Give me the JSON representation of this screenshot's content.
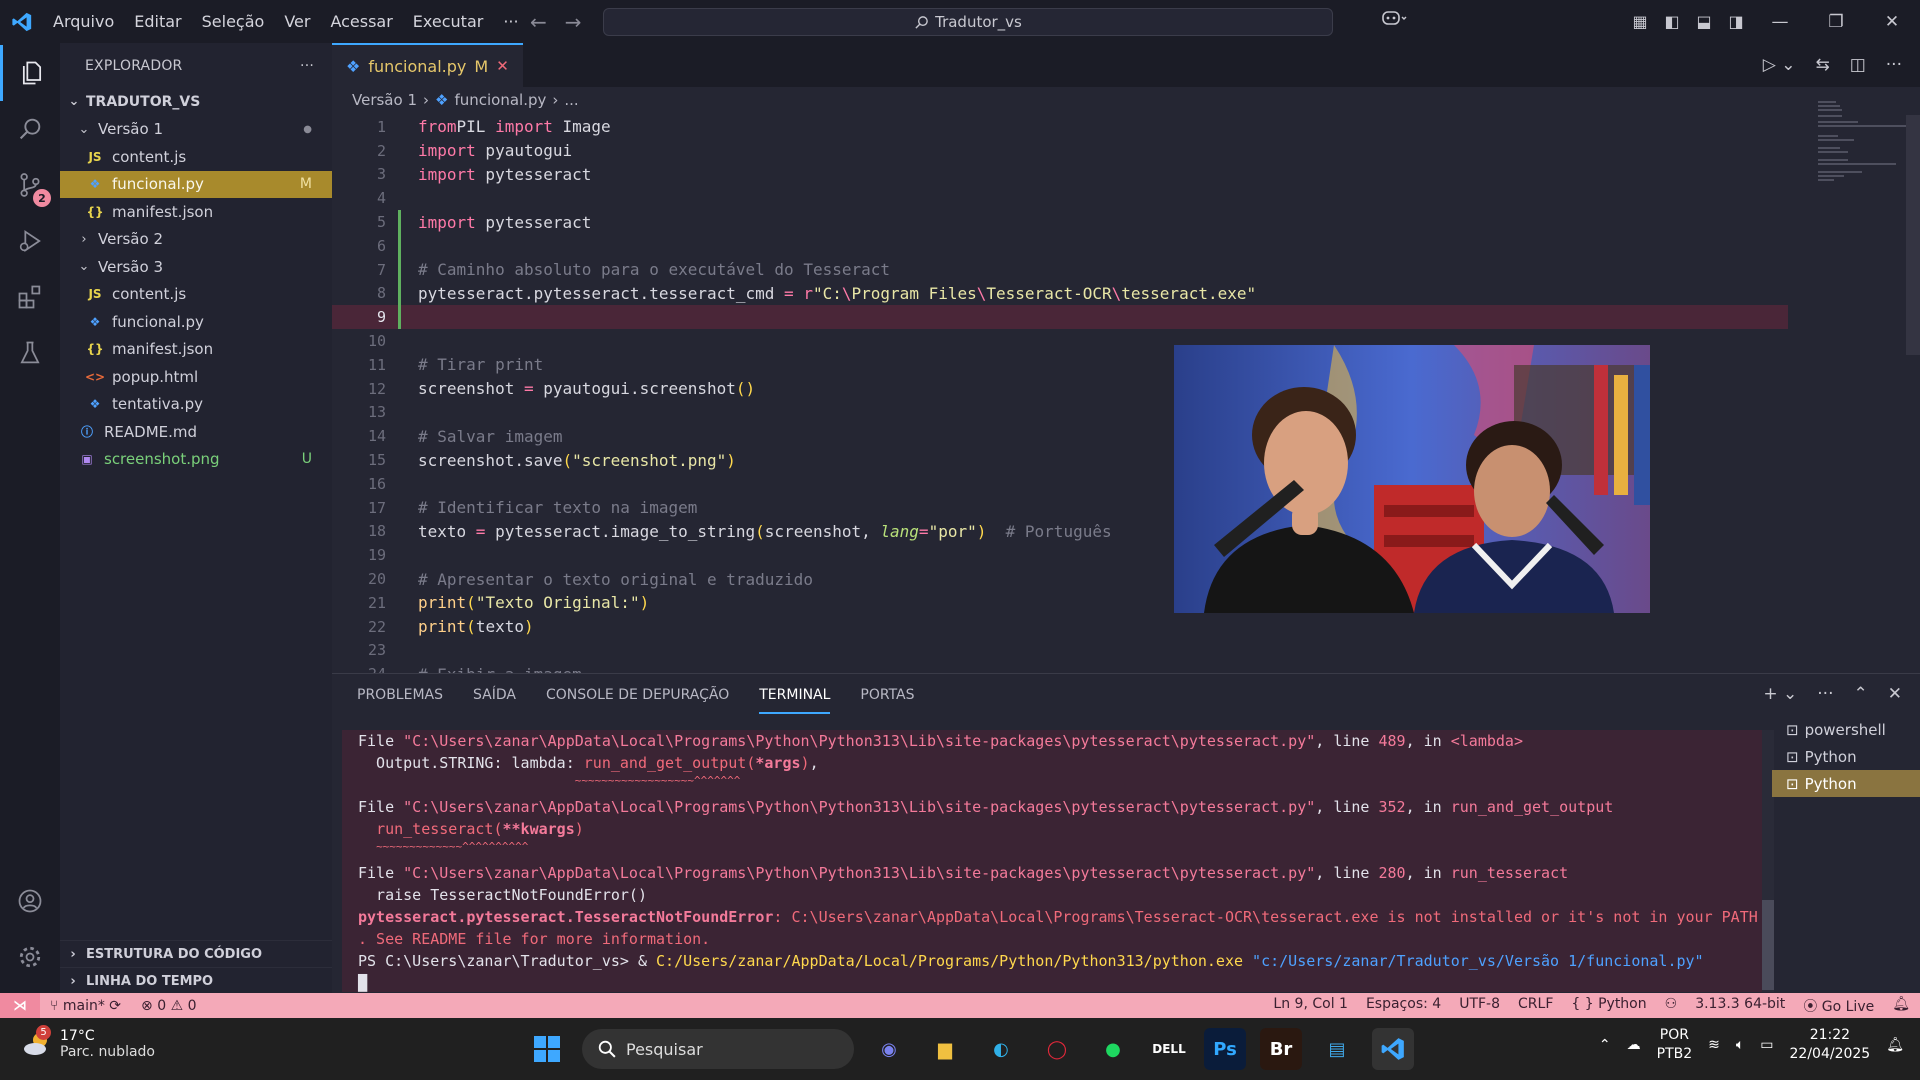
{
  "titlebar": {
    "menu": [
      "Arquivo",
      "Editar",
      "Seleção",
      "Ver",
      "Acessar",
      "Executar",
      "···"
    ],
    "search_text": "Tradutor_vs"
  },
  "activity": {
    "source_control_badge": "2"
  },
  "sidebar": {
    "title": "EXPLORADOR",
    "more": "···",
    "root": "TRADUTOR_VS",
    "items": [
      {
        "label": "Versão 1",
        "type": "folder",
        "open": true,
        "indent": 1,
        "status": "●"
      },
      {
        "label": "content.js",
        "type": "js",
        "indent": 2,
        "icon": "JS"
      },
      {
        "label": "funcional.py",
        "type": "py",
        "indent": 2,
        "status": "M",
        "selected": true
      },
      {
        "label": "manifest.json",
        "type": "json",
        "indent": 2,
        "icon": "{}"
      },
      {
        "label": "Versão 2",
        "type": "folder",
        "open": false,
        "indent": 1
      },
      {
        "label": "Versão 3",
        "type": "folder",
        "open": true,
        "indent": 1
      },
      {
        "label": "content.js",
        "type": "js",
        "indent": 2,
        "icon": "JS"
      },
      {
        "label": "funcional.py",
        "type": "py",
        "indent": 2
      },
      {
        "label": "manifest.json",
        "type": "json",
        "indent": 2,
        "icon": "{}"
      },
      {
        "label": "popup.html",
        "type": "html",
        "indent": 2,
        "icon": "<>"
      },
      {
        "label": "tentativa.py",
        "type": "py",
        "indent": 2
      },
      {
        "label": "README.md",
        "type": "md",
        "indent": 1,
        "icon": "ⓘ"
      },
      {
        "label": "screenshot.png",
        "type": "img",
        "indent": 1,
        "status": "U"
      }
    ],
    "outline": "ESTRUTURA DO CÓDIGO",
    "timeline": "LINHA DO TEMPO"
  },
  "editor": {
    "tab_label": "funcional.py",
    "tab_status": "M",
    "breadcrumb": [
      "Versão 1",
      "funcional.py",
      "..."
    ],
    "current_line": 9,
    "code": [
      [
        [
          "kw",
          "from"
        ],
        [
          "",
          "PIL "
        ],
        [
          "kw",
          "import"
        ],
        [
          "",
          " Image"
        ]
      ],
      [
        [
          "kw",
          "import"
        ],
        [
          "",
          " pyautogui"
        ]
      ],
      [
        [
          "kw",
          "import"
        ],
        [
          "",
          " pytesseract"
        ]
      ],
      [],
      [
        [
          "kw",
          "import"
        ],
        [
          "",
          " pytesseract"
        ]
      ],
      [],
      [
        [
          "cm",
          "# Caminho absoluto para o executável do Tesseract"
        ]
      ],
      [
        [
          "",
          "pytesseract.pytesseract.tesseract_cmd "
        ],
        [
          "op",
          "="
        ],
        [
          "",
          " "
        ],
        [
          "kw",
          "r"
        ],
        [
          "st",
          "\"C:"
        ],
        [
          "op",
          "\\"
        ],
        [
          "st",
          "Program Files"
        ],
        [
          "op",
          "\\"
        ],
        [
          "st",
          "Tesseract-OCR"
        ],
        [
          "op",
          "\\"
        ],
        [
          "st",
          "tesseract.exe\""
        ]
      ],
      [],
      [],
      [
        [
          "cm",
          "# Tirar print"
        ]
      ],
      [
        [
          "",
          "screenshot "
        ],
        [
          "op",
          "="
        ],
        [
          "",
          " pyautogui.screenshot"
        ],
        [
          "pa",
          "()"
        ]
      ],
      [],
      [
        [
          "cm",
          "# Salvar imagem"
        ]
      ],
      [
        [
          "",
          "screenshot.save"
        ],
        [
          "pa",
          "("
        ],
        [
          "st",
          "\"screenshot.png\""
        ],
        [
          "pa",
          ")"
        ]
      ],
      [],
      [
        [
          "cm",
          "# Identificar texto na imagem"
        ]
      ],
      [
        [
          "",
          "texto "
        ],
        [
          "op",
          "="
        ],
        [
          "",
          " pytesseract.image_to_string"
        ],
        [
          "pa",
          "("
        ],
        [
          "",
          "screenshot, "
        ],
        [
          "it",
          "lang"
        ],
        [
          "op",
          "="
        ],
        [
          "st",
          "\"por\""
        ],
        [
          "pa",
          ")"
        ],
        [
          "",
          "  "
        ],
        [
          "cm",
          "# Português"
        ]
      ],
      [],
      [
        [
          "cm",
          "# Apresentar o texto original e traduzido"
        ]
      ],
      [
        [
          "fn",
          "print"
        ],
        [
          "pa",
          "("
        ],
        [
          "st",
          "\"Texto Original:\""
        ],
        [
          "pa",
          ")"
        ]
      ],
      [
        [
          "fn",
          "print"
        ],
        [
          "pa",
          "("
        ],
        [
          "",
          "texto"
        ],
        [
          "pa",
          ")"
        ]
      ],
      [],
      [
        [
          "cm",
          "# Exibir a imagem"
        ]
      ]
    ]
  },
  "panel": {
    "tabs": [
      "PROBLEMAS",
      "SAÍDA",
      "CONSOLE DE DEPURAÇÃO",
      "TERMINAL",
      "PORTAS"
    ],
    "active_tab": "TERMINAL",
    "terminal_lines": [
      [
        [
          "",
          "File "
        ],
        [
          "path",
          "\"C:\\Users\\zanar\\AppData\\Local\\Programs\\Python\\Python313\\Lib\\site-packages\\pytesseract\\pytesseract.py\""
        ],
        [
          "",
          ", line "
        ],
        [
          "num",
          "489"
        ],
        [
          "",
          ", in "
        ],
        [
          "lam",
          "<lambda>"
        ]
      ],
      [
        [
          "",
          "  Output.STRING: lambda: "
        ],
        [
          "red",
          "run_and_get_output("
        ],
        [
          "err",
          "*args"
        ],
        [
          "red",
          ")"
        ],
        [
          "",
          ","
        ]
      ],
      [
        [
          "",
          "                        "
        ],
        [
          "red",
          "~~~~~~~~~~~~~~~~~~^^^^^^^"
        ]
      ],
      [
        [
          "",
          "File "
        ],
        [
          "path",
          "\"C:\\Users\\zanar\\AppData\\Local\\Programs\\Python\\Python313\\Lib\\site-packages\\pytesseract\\pytesseract.py\""
        ],
        [
          "",
          ", line "
        ],
        [
          "num",
          "352"
        ],
        [
          "",
          ", in "
        ],
        [
          "lam",
          "run_and_get_output"
        ]
      ],
      [
        [
          "",
          "  "
        ],
        [
          "red",
          "run_tesseract("
        ],
        [
          "err",
          "**kwargs"
        ],
        [
          "red",
          ")"
        ]
      ],
      [
        [
          "",
          "  "
        ],
        [
          "red",
          "~~~~~~~~~~~~~^^^^^^^^^^"
        ]
      ],
      [
        [
          "",
          "File "
        ],
        [
          "path",
          "\"C:\\Users\\zanar\\AppData\\Local\\Programs\\Python\\Python313\\Lib\\site-packages\\pytesseract\\pytesseract.py\""
        ],
        [
          "",
          ", line "
        ],
        [
          "num",
          "280"
        ],
        [
          "",
          ", in "
        ],
        [
          "lam",
          "run_tesseract"
        ]
      ],
      [
        [
          "",
          "  raise TesseractNotFoundError()"
        ]
      ],
      [
        [
          "err",
          "pytesseract.pytesseract.TesseractNotFoundError"
        ],
        [
          "red",
          ": C:\\Users\\zanar\\AppData\\Local\\Programs\\Tesseract-OCR\\tesseract.exe is not installed or it's not in your PATH"
        ]
      ],
      [
        [
          "red",
          ". See README file for more information."
        ]
      ],
      [
        [
          "",
          "PS C:\\Users\\zanar\\Tradutor_vs> & "
        ],
        [
          "yl",
          "C:/Users/zanar/AppData/Local/Programs/Python/Python313/python.exe"
        ],
        [
          "",
          " "
        ],
        [
          "bl",
          "\"c:/Users/zanar/Tradutor_vs/Versão 1/funcional.py\""
        ]
      ],
      [
        [
          "",
          "█"
        ]
      ]
    ],
    "terminals": [
      "powershell",
      "Python",
      "Python"
    ],
    "selected_terminal": 2
  },
  "statusbar": {
    "branch": "main*",
    "errors": "0",
    "warnings": "0",
    "position": "Ln 9, Col 1",
    "spaces": "Espaços: 4",
    "encoding": "UTF-8",
    "eol": "CRLF",
    "language": "{ } Python",
    "interpreter": "3.13.3 64-bit",
    "golive": "Go Live"
  },
  "taskbar": {
    "temperature": "17°C",
    "condition": "Parc. nublado",
    "weather_badge": "5",
    "search": "Pesquisar",
    "lang_top": "POR",
    "lang_bottom": "PTB2",
    "time": "21:22",
    "date": "22/04/2025"
  },
  "colors": {
    "accent": "#3ea8ff",
    "statusbar": "#f4a9b8",
    "selection": "#a88a2c",
    "terminal_bg": "#3b2434"
  }
}
